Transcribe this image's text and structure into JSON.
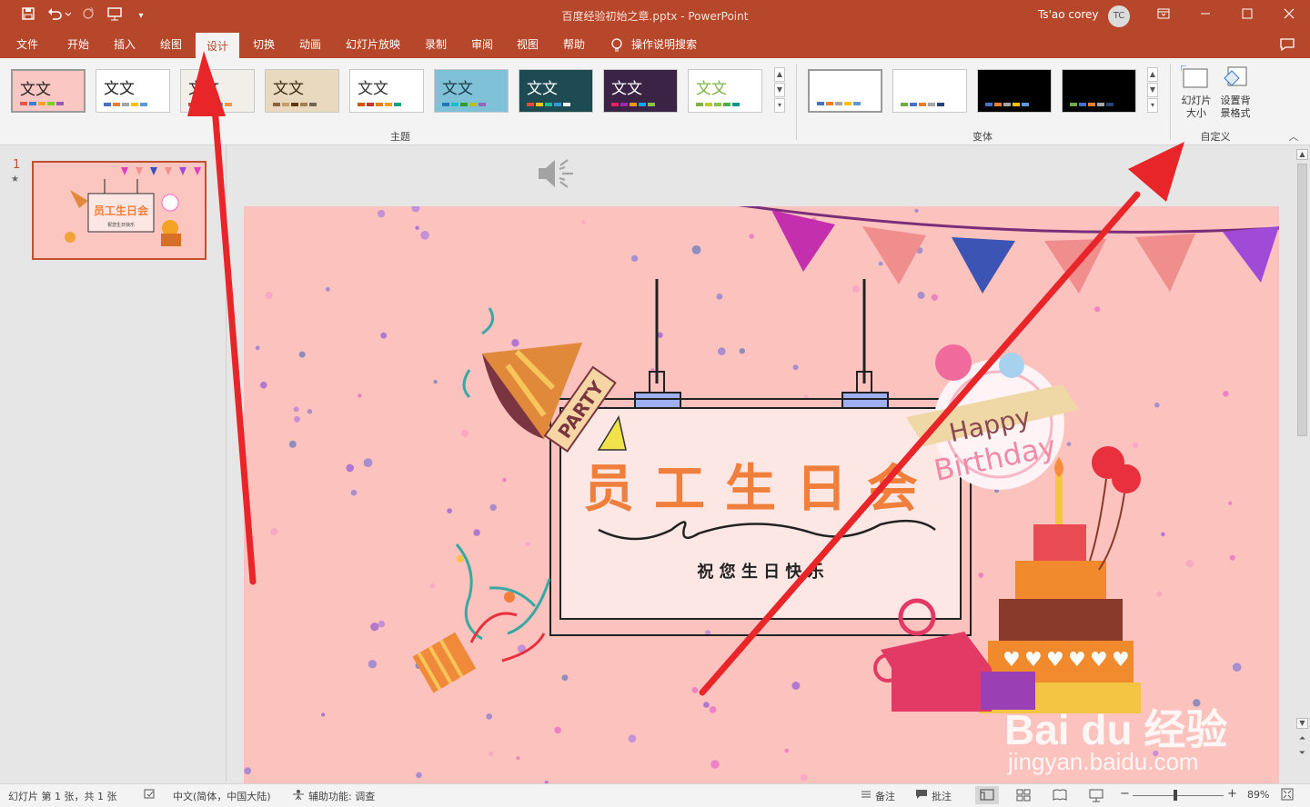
{
  "window": {
    "title": "百度经验初始之章.pptx  -  PowerPoint",
    "user_name": "Ts'ao corey",
    "user_initials": "TC"
  },
  "quick_access": {
    "save_icon": "save-icon",
    "undo_icon": "undo-icon",
    "redo_icon": "redo-icon",
    "present_icon": "present-from-start-icon",
    "customize_icon": "customize-qat-icon"
  },
  "menu": {
    "tabs": [
      "文件",
      "开始",
      "插入",
      "绘图",
      "设计",
      "切换",
      "动画",
      "幻灯片放映",
      "录制",
      "审阅",
      "视图",
      "帮助"
    ],
    "active": "设计",
    "search_label": "操作说明搜索"
  },
  "ribbon": {
    "themes_label": "主题",
    "variants_label": "变体",
    "customize_label": "自定义",
    "theme_sample_text": "文文",
    "slide_size_label_1": "幻灯片",
    "slide_size_label_2": "大小",
    "bg_format_label_1": "设置背",
    "bg_format_label_2": "景格式",
    "themes": [
      {
        "bg": "#fbc7c2",
        "fg": "#222222",
        "bars": [
          "#e2574c",
          "#3a7bd5",
          "#f5a623",
          "#7ed321",
          "#9b59b6"
        ]
      },
      {
        "bg": "#ffffff",
        "fg": "#222222",
        "bars": [
          "#4472c4",
          "#ed7d31",
          "#a5a5a5",
          "#ffc000",
          "#5b9bd5"
        ]
      },
      {
        "bg": "#f2eeea",
        "fg": "#222222",
        "bars": [
          "#c0504d",
          "#9bbb59",
          "#8064a2",
          "#4bacc6",
          "#f79646"
        ]
      },
      {
        "bg": "#e8d9bf",
        "fg": "#3b2a12",
        "bars": [
          "#8c6239",
          "#c69c6d",
          "#603913",
          "#a67c52",
          "#736357"
        ]
      },
      {
        "bg": "#ffffff",
        "fg": "#333333",
        "bars": [
          "#d35400",
          "#c0392b",
          "#e67e22",
          "#f39c12",
          "#16a085"
        ]
      },
      {
        "bg": "#7fc1d6",
        "fg": "#1b3a4b",
        "bars": [
          "#1f77b4",
          "#17becf",
          "#2ca02c",
          "#bcbd22",
          "#9467bd"
        ]
      },
      {
        "bg": "#1e4a53",
        "fg": "#ffffff",
        "bars": [
          "#e74c3c",
          "#f1c40f",
          "#1abc9c",
          "#3498db",
          "#ecf0f1"
        ]
      },
      {
        "bg": "#3b2346",
        "fg": "#ffffff",
        "bars": [
          "#e91e63",
          "#9c27b0",
          "#ff9800",
          "#03a9f4",
          "#8bc34a"
        ]
      },
      {
        "bg": "#ffffff",
        "fg": "#7cb342",
        "bars": [
          "#7cb342",
          "#c0ca33",
          "#8bc34a",
          "#4caf50",
          "#009688"
        ]
      }
    ],
    "variants": [
      {
        "bg": "#ffffff",
        "bars": [
          "#4472c4",
          "#ed7d31",
          "#a5a5a5",
          "#ffc000",
          "#5b9bd5"
        ]
      },
      {
        "bg": "#ffffff",
        "bars": [
          "#70ad47",
          "#4472c4",
          "#ed7d31",
          "#a5a5a5",
          "#264478"
        ]
      },
      {
        "bg": "#000000",
        "bars": [
          "#4472c4",
          "#ed7d31",
          "#a5a5a5",
          "#ffc000",
          "#5b9bd5"
        ]
      },
      {
        "bg": "#000000",
        "bars": [
          "#70ad47",
          "#4472c4",
          "#ed7d31",
          "#a5a5a5",
          "#264478"
        ]
      }
    ]
  },
  "slides_panel": {
    "slide_number": "1",
    "star": "★"
  },
  "slide": {
    "title": "员工生日会",
    "subtitle": "祝 您 生 日 快 乐",
    "party_text": "PARTY",
    "happy_text": "Happy",
    "birthday_text": "Birthday",
    "audio_icon": "speaker-icon"
  },
  "watermark": {
    "brand": "Bai du 经验",
    "url": "jingyan.baidu.com"
  },
  "status": {
    "slide_info": "幻灯片 第 1 张，共 1 张",
    "language": "中文(简体，中国大陆)",
    "accessibility": "辅助功能: 调查",
    "notes": "备注",
    "comments": "批注",
    "zoom": "89%"
  },
  "colors": {
    "accent": "#b7472a",
    "slide_bg": "#fcc2bd",
    "title_orange": "#f07f3c",
    "arrow_red": "#e8262a"
  }
}
